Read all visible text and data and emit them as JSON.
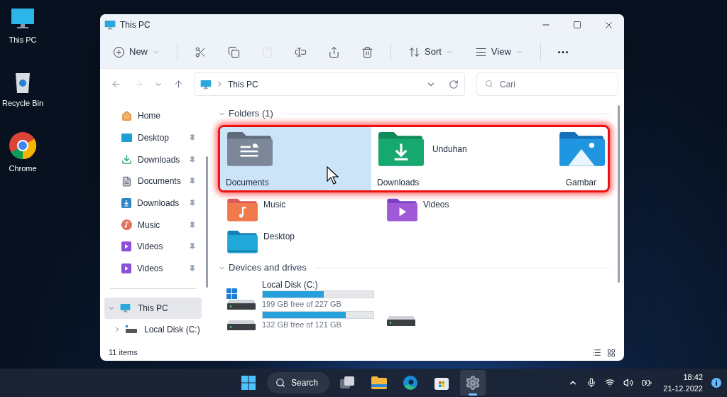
{
  "desktop_icons": [
    {
      "label": "This PC",
      "kind": "pc"
    },
    {
      "label": "Recycle Bin",
      "kind": "bin"
    },
    {
      "label": "Chrome",
      "kind": "browser"
    }
  ],
  "window": {
    "title": "This PC"
  },
  "toolbar": [
    {
      "kind": "new",
      "label": "New",
      "disabled": false
    },
    {
      "kind": "cut",
      "disabled": false
    },
    {
      "kind": "copy",
      "disabled": false
    },
    {
      "kind": "paste",
      "disabled": true
    },
    {
      "kind": "rename",
      "disabled": false
    },
    {
      "kind": "share",
      "disabled": false
    },
    {
      "kind": "delete",
      "disabled": false
    },
    {
      "kind": "sort",
      "label": "Sort",
      "disabled": false
    },
    {
      "kind": "view",
      "label": "View",
      "disabled": false
    },
    {
      "kind": "more",
      "disabled": false
    }
  ],
  "nav": {
    "forward_disabled": true
  },
  "address": {
    "path": "This PC"
  },
  "search": {
    "placeholder": "Cari"
  },
  "sidebar": {
    "quick_access": [
      {
        "label": "Home",
        "kind": "home",
        "pinned": false
      },
      {
        "label": "Desktop",
        "kind": "desktop",
        "pinned": true
      },
      {
        "label": "Downloads",
        "kind": "download",
        "pinned": true
      },
      {
        "label": "Documents",
        "kind": "document",
        "pinned": true
      },
      {
        "label": "Downloads",
        "kind": "download-box",
        "pinned": true
      },
      {
        "label": "Music",
        "kind": "music",
        "pinned": true
      },
      {
        "label": "Videos",
        "kind": "video",
        "pinned": true
      },
      {
        "label": "Videos",
        "kind": "video",
        "pinned": true
      }
    ],
    "tree": [
      {
        "label": "This PC",
        "kind": "pc",
        "expanded": true,
        "selected": true,
        "children": [
          {
            "label": "Local Disk (C:)",
            "kind": "drive",
            "expanded": false,
            "selected": false
          }
        ]
      }
    ]
  },
  "folders_section": {
    "title": "Folders (1)",
    "expanded": true,
    "highlighted": [
      {
        "label": "Documents",
        "kind": "documents",
        "selected": true
      },
      {
        "label": "Downloads",
        "side_label": "Unduhan",
        "kind": "downloads",
        "selected": false
      },
      {
        "label": "Gambar",
        "kind": "pictures",
        "selected": false
      }
    ],
    "items": [
      {
        "label": "Music",
        "kind": "music"
      },
      {
        "label": "Videos",
        "kind": "videos"
      },
      {
        "label": "Desktop",
        "kind": "desktop"
      }
    ]
  },
  "drives_section": {
    "title": "Devices and drives",
    "expanded": true,
    "drives": [
      {
        "kind": "bar",
        "name": "Local Disk (C:)",
        "system": true,
        "level": 0.55,
        "free": "199 GB free of 227 GB"
      },
      {
        "kind": "bar",
        "system": false,
        "level": 0.75,
        "free": "132 GB free of 121 GB"
      },
      {
        "kind": "plain"
      }
    ]
  },
  "status_bar": {
    "count": "11 items"
  },
  "taskbar": {
    "search": "Search",
    "apps": [
      {
        "kind": "taskview",
        "active": false
      },
      {
        "kind": "explorer",
        "active": false
      },
      {
        "kind": "edge",
        "active": false
      },
      {
        "kind": "store",
        "active": false
      },
      {
        "kind": "settings",
        "active": true
      }
    ],
    "time": "18:42",
    "date": "21-12.2022"
  }
}
